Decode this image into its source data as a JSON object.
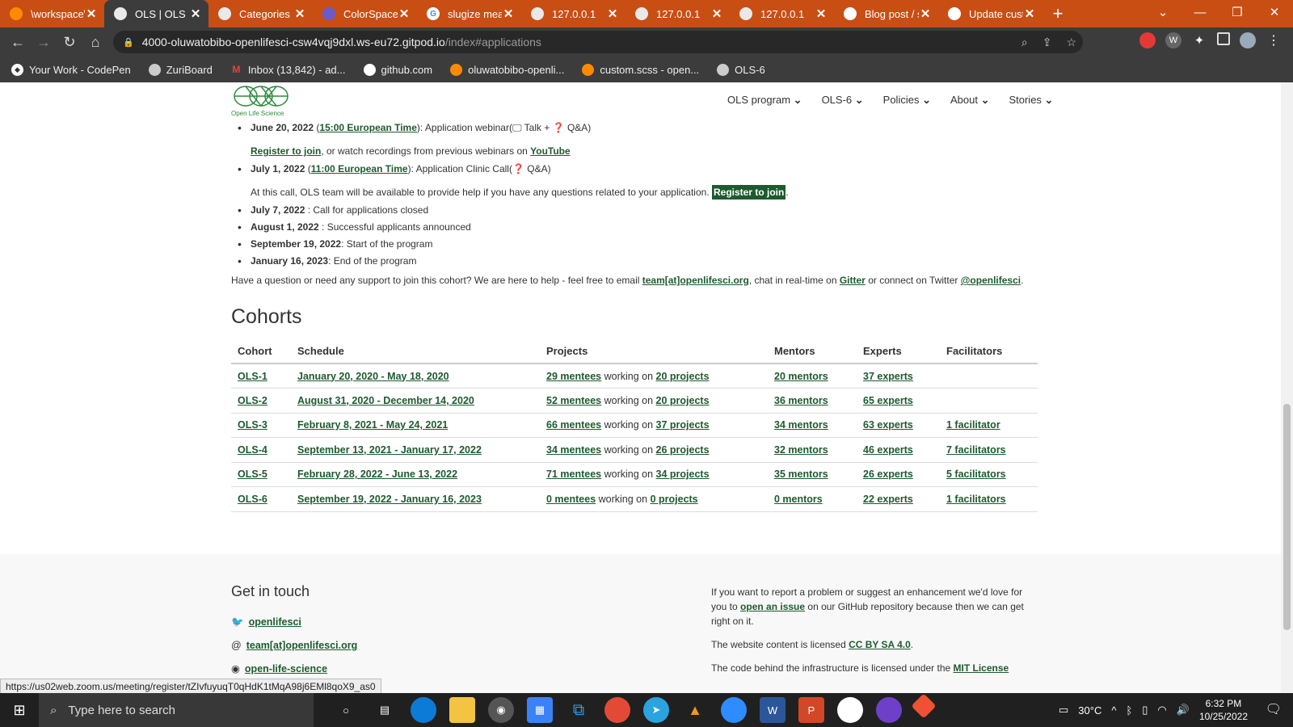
{
  "browser": {
    "tabs": [
      {
        "label": "\\workspace\\",
        "icon": "gitpod-icon",
        "active": false
      },
      {
        "label": "OLS | OLS",
        "icon": "globe-icon",
        "active": true
      },
      {
        "label": "Categories |",
        "icon": "globe-icon",
        "active": false
      },
      {
        "label": "ColorSpace -",
        "icon": "colorspace-icon",
        "active": false
      },
      {
        "label": "slugize mean",
        "icon": "google-icon",
        "active": false
      },
      {
        "label": "127.0.0.1",
        "icon": "globe-icon",
        "active": false
      },
      {
        "label": "127.0.0.1",
        "icon": "globe-icon",
        "active": false
      },
      {
        "label": "127.0.0.1",
        "icon": "globe-icon",
        "active": false
      },
      {
        "label": "Blog post / s",
        "icon": "github-icon",
        "active": false
      },
      {
        "label": "Update custo",
        "icon": "github-icon",
        "active": false
      }
    ],
    "url_main": "4000-oluwatobibo-openlifesci-csw4vqj9dxl.ws-eu72.gitpod.io",
    "url_path": "/index#applications",
    "bookmarks": [
      {
        "label": "Your Work - CodePen",
        "icon": "codepen-icon"
      },
      {
        "label": "ZuriBoard",
        "icon": "globe-icon"
      },
      {
        "label": "Inbox (13,842) - ad...",
        "icon": "gmail-icon"
      },
      {
        "label": "github.com",
        "icon": "github-icon"
      },
      {
        "label": "oluwatobibo-openli...",
        "icon": "gitpod-icon"
      },
      {
        "label": "custom.scss - open...",
        "icon": "gitpod-icon"
      },
      {
        "label": "OLS-6",
        "icon": "globe-icon"
      }
    ],
    "status_url": "https://us02web.zoom.us/meeting/register/tZIvfuyuqT0qHdK1tMqA98j6EMl8qoX9_as0"
  },
  "site": {
    "logo_text": "Open Life Science",
    "nav": [
      "OLS program",
      "OLS-6",
      "Policies",
      "About",
      "Stories"
    ]
  },
  "timeline": {
    "item1_date": "June 20, 2022",
    "item1_time": "15:00 European Time",
    "item1_text": "): Application webinar(",
    "item1_tail": "Talk + ❓ Q&A)",
    "item1_register": "Register to join",
    "item1_sub": ", or watch recordings from previous webinars on ",
    "item1_youtube": "YouTube",
    "item2_date": "July 1, 2022",
    "item2_time": "11:00 European Time",
    "item2_text": "): Application Clinic Call(❓ Q&A)",
    "item2_sub": "At this call, OLS team will be available to provide help if you have any questions related to your application.",
    "item2_register": "Register to join",
    "item3_date": "July 7, 2022",
    "item3_text": " : Call for applications closed",
    "item4_date": "August 1, 2022",
    "item4_text": " : Successful applicants announced",
    "item5_date": "September 19, 2022",
    "item5_text": ": Start of the program",
    "item6_date": "January 16, 2023",
    "item6_text": ": End of the program"
  },
  "support": {
    "text1": "Have a question or need any support to join this cohort? We are here to help - feel free to email ",
    "email": "team[at]openlifesci.org",
    "text2": ", chat in real-time on ",
    "gitter": "Gitter",
    "text3": " or connect on Twitter ",
    "twitter": "@openlifesci",
    "text4": "."
  },
  "cohorts": {
    "title": "Cohorts",
    "headers": [
      "Cohort",
      "Schedule",
      "Projects",
      "Mentors",
      "Experts",
      "Facilitators"
    ],
    "working_on": "working on",
    "rows": [
      {
        "cohort": "OLS-1",
        "schedule": "January 20, 2020 - May 18, 2020",
        "mentees": "29 mentees",
        "projects": "20 projects",
        "mentors": "20 mentors",
        "experts": "37 experts",
        "facilitators": ""
      },
      {
        "cohort": "OLS-2",
        "schedule": "August 31, 2020 - December 14, 2020",
        "mentees": "52 mentees",
        "projects": "20 projects",
        "mentors": "36 mentors",
        "experts": "65 experts",
        "facilitators": ""
      },
      {
        "cohort": "OLS-3",
        "schedule": "February 8, 2021 - May 24, 2021",
        "mentees": "66 mentees",
        "projects": "37 projects",
        "mentors": "34 mentors",
        "experts": "63 experts",
        "facilitators": "1 facilitator"
      },
      {
        "cohort": "OLS-4",
        "schedule": "September 13, 2021 - January 17, 2022",
        "mentees": "34 mentees",
        "projects": "26 projects",
        "mentors": "32 mentors",
        "experts": "46 experts",
        "facilitators": "7 facilitators"
      },
      {
        "cohort": "OLS-5",
        "schedule": "February 28, 2022 - June 13, 2022",
        "mentees": "71 mentees",
        "projects": "34 projects",
        "mentors": "35 mentors",
        "experts": "26 experts",
        "facilitators": "5 facilitators"
      },
      {
        "cohort": "OLS-6",
        "schedule": "September 19, 2022 - January 16, 2023",
        "mentees": "0 mentees",
        "projects": "0 projects",
        "mentors": "0 mentors",
        "experts": "22 experts",
        "facilitators": "1 facilitators"
      }
    ]
  },
  "footer": {
    "title": "Get in touch",
    "twitter": "openlifesci",
    "email": "team[at]openlifesci.org",
    "partial": "open-life-science",
    "issue_text1": "If you want to report a problem or suggest an enhancement we'd love for you to ",
    "issue_link": "open an issue",
    "issue_text2": " on our GitHub repository because then we can get right on it.",
    "license_text": "The website content is licensed ",
    "license_link": "CC BY SA 4.0",
    "license_end": ".",
    "code_text": "The code behind the infrastructure is licensed under the ",
    "code_link": "MIT License"
  },
  "taskbar": {
    "search_placeholder": "Type here to search",
    "temperature": "30°C",
    "time": "6:32 PM",
    "date": "10/25/2022",
    "apps": [
      "cortana-icon",
      "taskview-icon",
      "edge-icon",
      "explorer-icon",
      "obs-icon",
      "store-icon",
      "vscode-icon",
      "chrome-icon",
      "telegram-icon",
      "vlc-icon",
      "zoom-icon",
      "word-icon",
      "powerpoint-icon",
      "slack-icon",
      "github-desktop-icon",
      "git-icon"
    ]
  },
  "colors": {
    "accent": "#1e5a2f",
    "tabbar": "#c94e14"
  }
}
